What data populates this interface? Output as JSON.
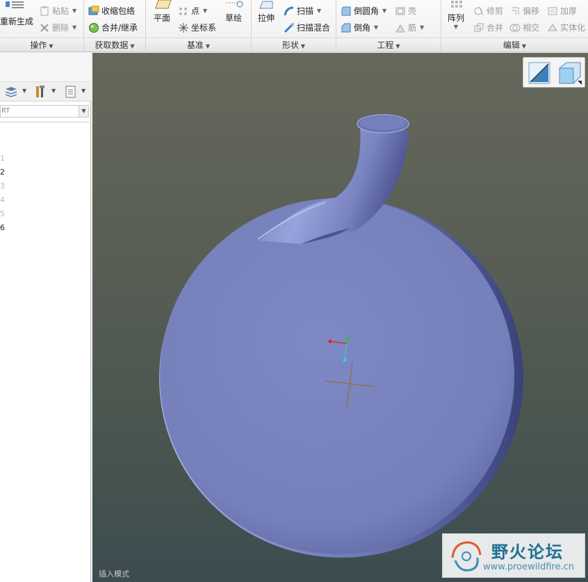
{
  "ribbon": {
    "operations": {
      "label": "操作",
      "regenerate": "重新生成",
      "paste": "粘贴",
      "delete": "删除"
    },
    "get_data": {
      "label": "获取数据",
      "shrinkwrap": "收缩包络",
      "merge_inherit": "合并/继承"
    },
    "datum": {
      "label": "基准",
      "plane": "平面",
      "point": "点",
      "csys": "坐标系",
      "sketch": "草绘"
    },
    "shapes": {
      "label": "形状",
      "extrude": "拉伸",
      "sweep": "扫描",
      "swept_blend": "扫描混合"
    },
    "engineering": {
      "label": "工程",
      "round": "倒圆角",
      "chamfer": "倒角",
      "shell": "壳",
      "rib": "筋"
    },
    "editing": {
      "label": "编辑",
      "pattern": "阵列",
      "trim": "修剪",
      "offset": "偏移",
      "thicken": "加厚",
      "merge": "合并",
      "intersect": "相交",
      "solidify": "实体化"
    }
  },
  "left_pane": {
    "filter_text": "RT",
    "tree_items": [
      {
        "label": "1",
        "active": false
      },
      {
        "label": "2",
        "active": true
      },
      {
        "label": "3",
        "active": false
      },
      {
        "label": "4",
        "active": false
      },
      {
        "label": "5",
        "active": false
      },
      {
        "label": "6",
        "active": true
      }
    ]
  },
  "viewport": {
    "status_text": "插入模式",
    "model_color": "#7a85c0",
    "watermark_title": "野火论坛",
    "watermark_url": "www.proewildfire.cn"
  }
}
